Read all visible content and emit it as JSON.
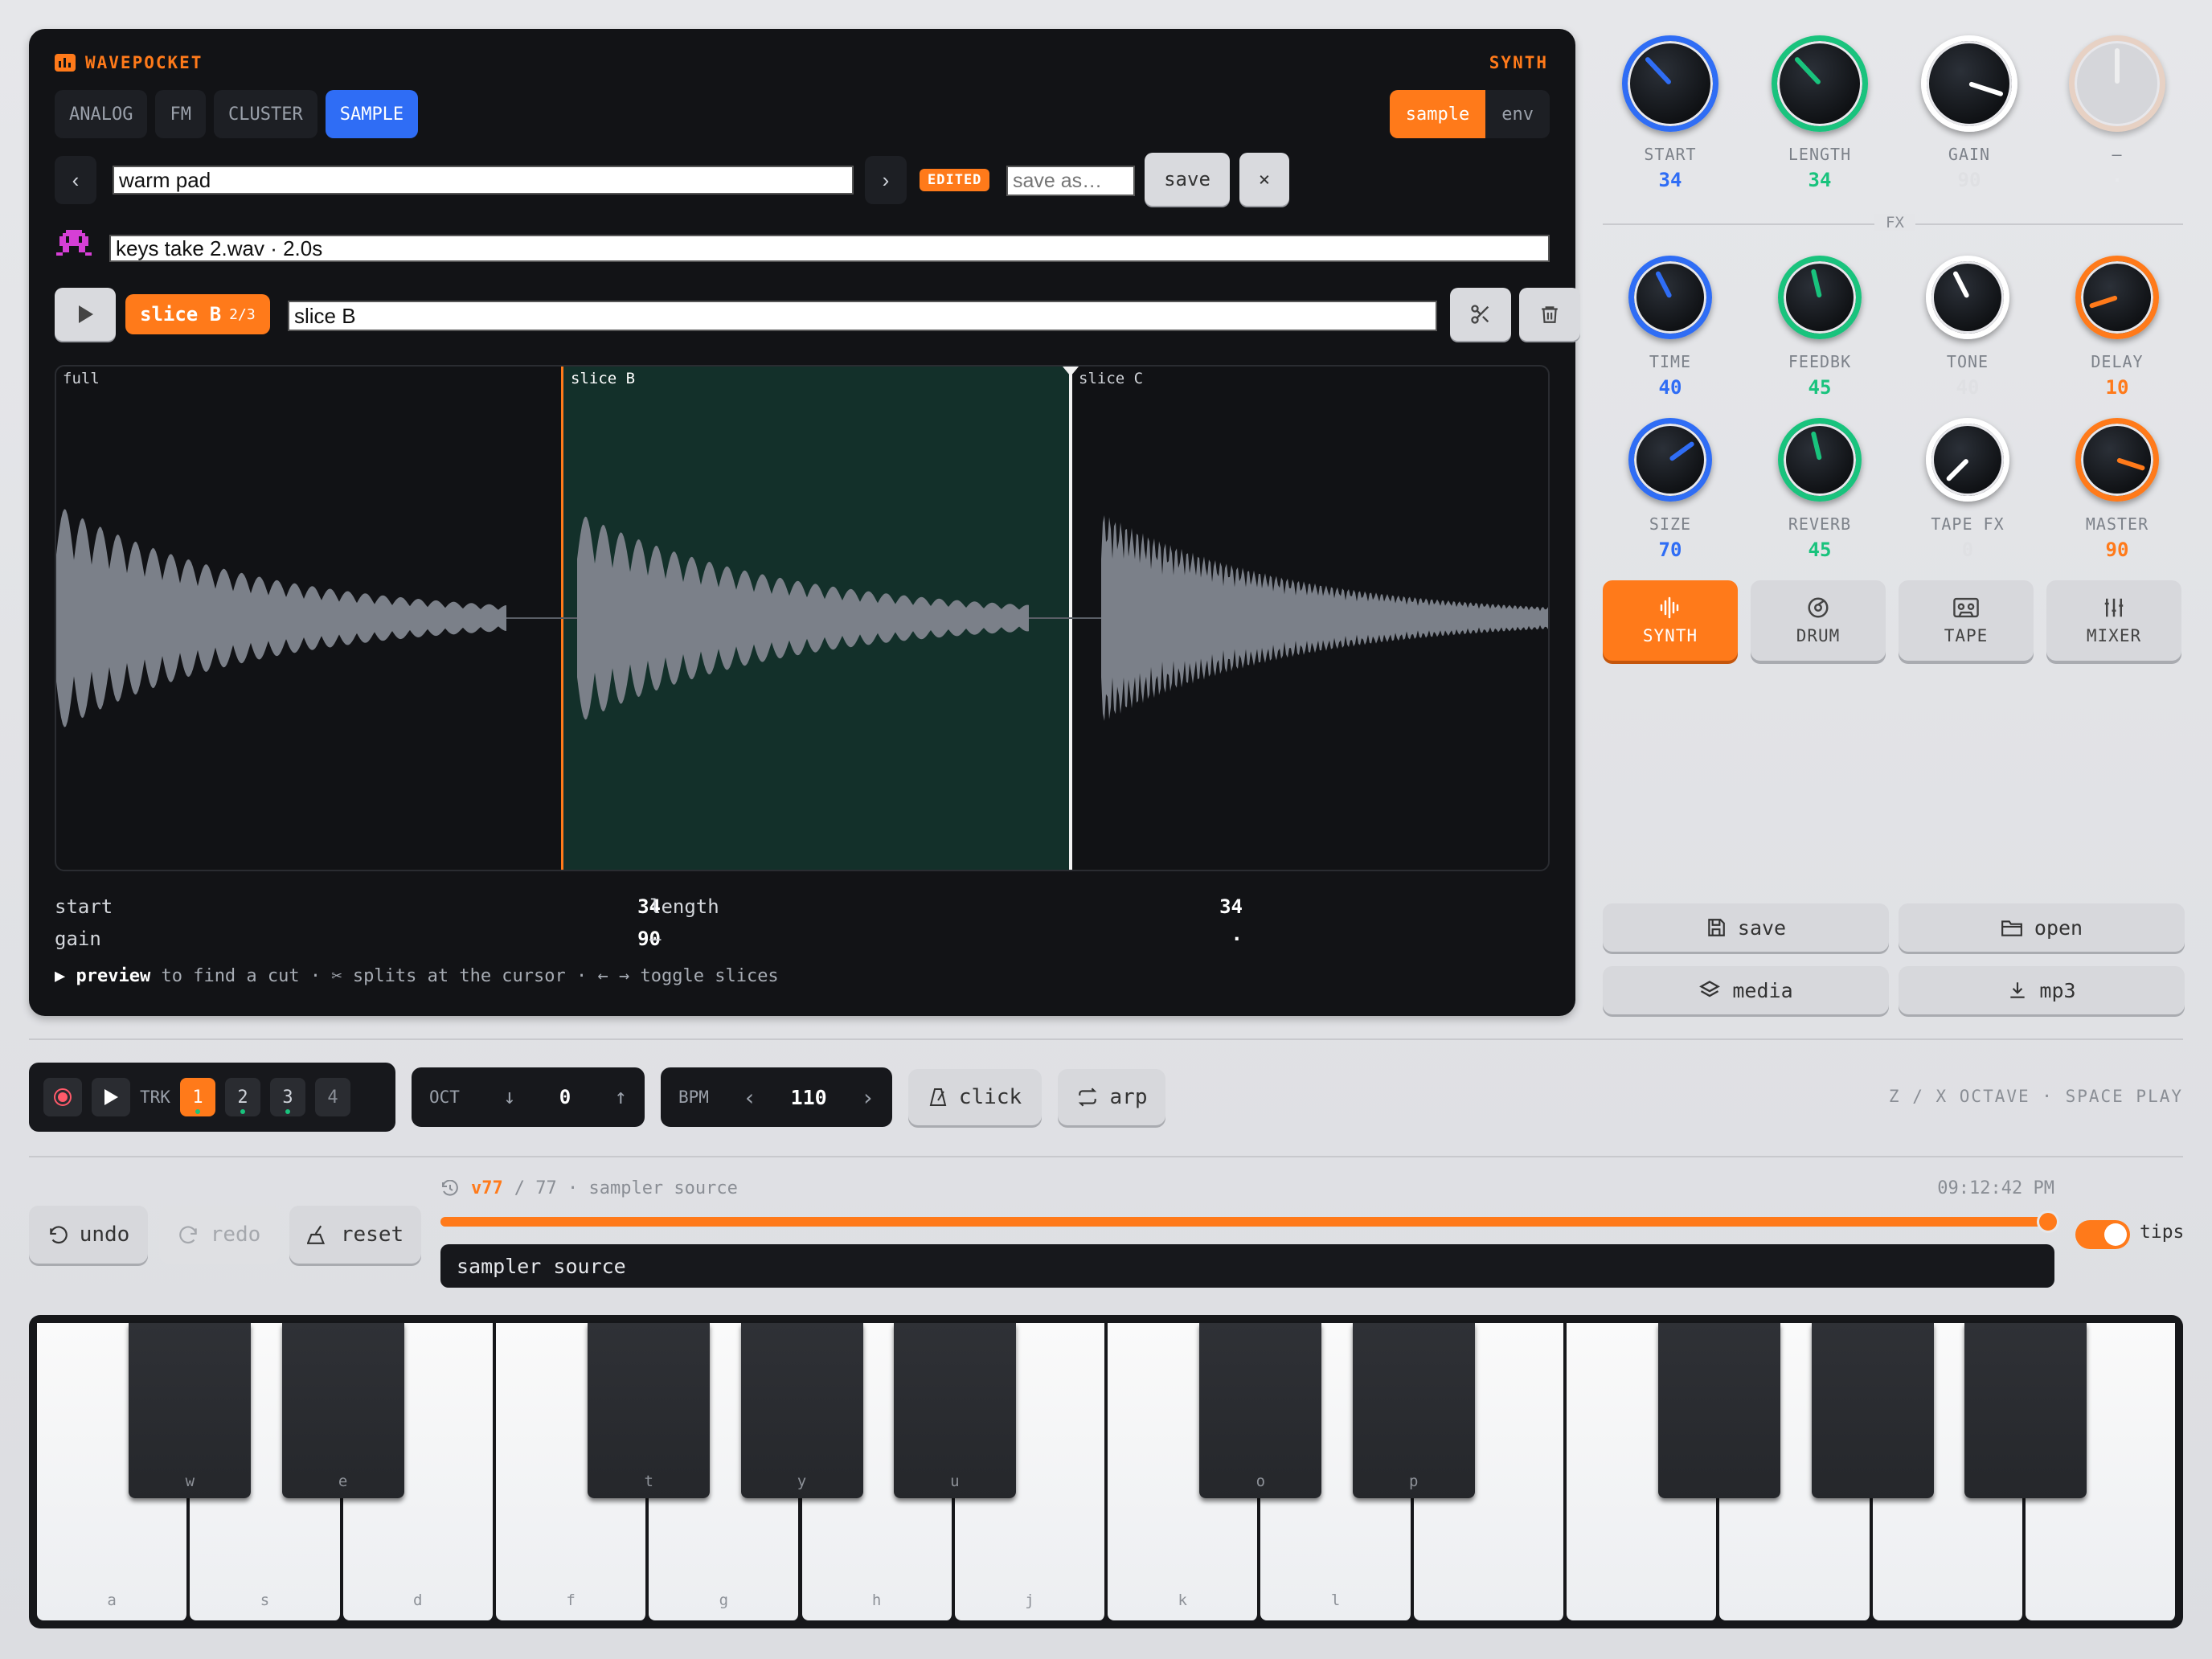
{
  "app": {
    "brand": "WAVEPOCKET",
    "mode_label": "SYNTH"
  },
  "engine_tabs": [
    {
      "label": "ANALOG",
      "active": false
    },
    {
      "label": "FM",
      "active": false
    },
    {
      "label": "CLUSTER",
      "active": false
    },
    {
      "label": "SAMPLE",
      "active": true
    }
  ],
  "view_toggle": {
    "sample": "sample",
    "env": "env",
    "selected": "sample"
  },
  "preset": {
    "name": "warm pad",
    "badge": "EDITED",
    "save_as_placeholder": "save as…",
    "save_label": "save",
    "close_label": "×"
  },
  "sample_file": {
    "value": "keys take 2.wav · 2.0s"
  },
  "slice": {
    "badge": "slice B",
    "count": "2/3",
    "name_value": "slice B"
  },
  "waveform": {
    "segments": [
      "full",
      "slice B",
      "slice C"
    ]
  },
  "params": {
    "start_label": "start",
    "start_value": "34",
    "length_label": "length",
    "length_value": "34",
    "gain_label": "gain",
    "gain_value": "90",
    "dash_label": "—",
    "dash_value": "·"
  },
  "hint": {
    "b1": "▶ preview",
    "t1": " to find a cut · ✂ splits at the cursor · ← → toggle slices"
  },
  "knobs_top": [
    {
      "label": "START",
      "value": "34",
      "color": "#2f6df5",
      "level": 34
    },
    {
      "label": "LENGTH",
      "value": "34",
      "color": "#19c37d",
      "level": 34
    },
    {
      "label": "GAIN",
      "value": "90",
      "color": "#ffffff",
      "level": 90
    },
    {
      "label": "—",
      "value": "·",
      "color": "#e8c9b4",
      "level": 50
    }
  ],
  "fx_label": "FX",
  "knobs_fx": [
    {
      "label": "TIME",
      "value": "40",
      "color": "#2f6df5",
      "level": 40
    },
    {
      "label": "FEEDBK",
      "value": "45",
      "color": "#19c37d",
      "level": 45
    },
    {
      "label": "TONE",
      "value": "40",
      "color": "#ffffff",
      "level": 40
    },
    {
      "label": "DELAY",
      "value": "10",
      "color": "#ff7a1a",
      "level": 10
    },
    {
      "label": "SIZE",
      "value": "70",
      "color": "#2f6df5",
      "level": 70
    },
    {
      "label": "REVERB",
      "value": "45",
      "color": "#19c37d",
      "level": 45
    },
    {
      "label": "TAPE FX",
      "value": "0",
      "color": "#ffffff",
      "level": 0
    },
    {
      "label": "MASTER",
      "value": "90",
      "color": "#ff7a1a",
      "level": 90
    }
  ],
  "modes": [
    {
      "label": "SYNTH",
      "active": true
    },
    {
      "label": "DRUM",
      "active": false
    },
    {
      "label": "TAPE",
      "active": false
    },
    {
      "label": "MIXER",
      "active": false
    }
  ],
  "file_buttons": {
    "save": "save",
    "open": "open",
    "media": "media",
    "mp3": "mp3"
  },
  "transport": {
    "trk_label": "TRK",
    "tracks": [
      "1",
      "2",
      "3",
      "4"
    ],
    "active_track": "1"
  },
  "octave": {
    "label": "OCT",
    "value": "0"
  },
  "bpm": {
    "label": "BPM",
    "value": "110"
  },
  "click_label": "click",
  "arp_label": "arp",
  "shortcut_hint": "Z / X OCTAVE · SPACE PLAY",
  "history": {
    "version": "v77",
    "total": "/ 77 · sampler source",
    "time": "09:12:42 PM",
    "progress_fraction": 1.0,
    "current_label": "sampler source"
  },
  "edit_buttons": {
    "undo": "undo",
    "redo": "redo",
    "reset": "reset"
  },
  "tips": {
    "label": "tips",
    "on": true
  },
  "keyboard": {
    "white_keys": [
      "a",
      "s",
      "d",
      "f",
      "g",
      "h",
      "j",
      "k",
      "l",
      "",
      "",
      "",
      "",
      ""
    ],
    "black_keys": [
      "w",
      "e",
      "t",
      "y",
      "u",
      "o",
      "p",
      "",
      "",
      ""
    ]
  },
  "colors": {
    "accent": "#ff7a1a",
    "blue": "#2f6df5",
    "green": "#19c37d",
    "screen": "#121316"
  }
}
